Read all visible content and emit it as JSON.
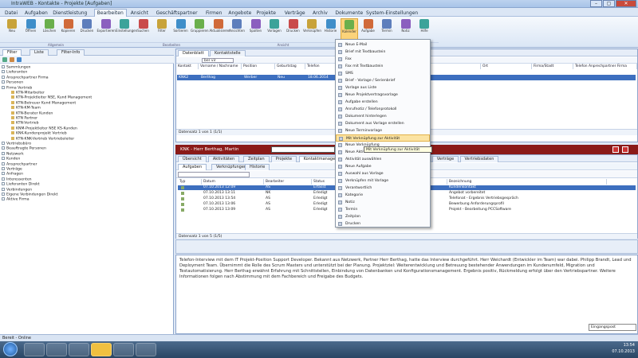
{
  "window": {
    "title": "IntraWEB - Kontakte - Projekte [Aufgaben]"
  },
  "menubar": {
    "tabs": [
      "Datei",
      "Aufgaben",
      "Dienstleistung",
      "Bearbeiten",
      "Ansicht",
      "Geschäftspartner",
      "Firmen",
      "Angebote",
      "Projekte",
      "Verträge",
      "Archiv",
      "Dokumente",
      "System-Einstellungen"
    ],
    "active_index": 3
  },
  "ribbon": {
    "buttons": [
      "Neu",
      "Öffnen",
      "Löschen",
      "Kopieren",
      "Drucken",
      "Exportieren",
      "Einstellungen",
      "Suchen",
      "Filter",
      "Sortieren",
      "Gruppieren",
      "Aktualisieren",
      "Ansichten",
      "Spalten",
      "Vorlagen",
      "Drucken",
      "Verknüpfen",
      "Historie",
      "Kalender",
      "Aufgabe",
      "Termin",
      "Notiz",
      "Hilfe"
    ],
    "selected_index": 18,
    "groups": [
      "Allgemein",
      "Bearbeiten",
      "Ansicht",
      "Extras"
    ]
  },
  "left_panel": {
    "tabs": [
      "Filter",
      "Liste",
      "Filter-Info"
    ],
    "tree": [
      {
        "label": "Sammlungen",
        "depth": 0
      },
      {
        "label": "Lieferanten",
        "depth": 0
      },
      {
        "label": "Ansprechpartner Firma",
        "depth": 0
      },
      {
        "label": "Personen",
        "depth": 0
      },
      {
        "label": "Firma Vertrieb",
        "depth": 0
      },
      {
        "label": "KTN-Mitarbeiter",
        "depth": 1
      },
      {
        "label": "KTN-Projektleiter NSE, Kund Management",
        "depth": 1
      },
      {
        "label": "KTN-Betreuer Kund Management",
        "depth": 1
      },
      {
        "label": "KTN-KM-Team",
        "depth": 1
      },
      {
        "label": "KTN-Berater Kunden",
        "depth": 1
      },
      {
        "label": "KTN Partner",
        "depth": 1
      },
      {
        "label": "KTN-Vertrieb",
        "depth": 1
      },
      {
        "label": "KNM-Projektleiter NSE KS-Kunden",
        "depth": 1
      },
      {
        "label": "KNK-Kundenprojekt Vertrieb",
        "depth": 1
      },
      {
        "label": "KTN-KNK-Vertrieb Vertriebsleiter",
        "depth": 1
      },
      {
        "label": "Vertriebsbüro",
        "depth": 0
      },
      {
        "label": "Beauftragte Personen",
        "depth": 0
      },
      {
        "label": "Netzwerk",
        "depth": 0
      },
      {
        "label": "Kunden",
        "depth": 0
      },
      {
        "label": "Ansprechpartner",
        "depth": 0
      },
      {
        "label": "Verträge",
        "depth": 0
      },
      {
        "label": "Anfragen",
        "depth": 0
      },
      {
        "label": "Interessenten",
        "depth": 0
      },
      {
        "label": "Lieferanten Direkt",
        "depth": 0
      },
      {
        "label": "Verbindungen",
        "depth": 0
      },
      {
        "label": "Eigene Verbindungen Direkt",
        "depth": 0
      },
      {
        "label": "Aktive Firma",
        "depth": 0
      }
    ]
  },
  "grid1": {
    "tabs": [
      "Datenblatt",
      "Kontaktstelle"
    ],
    "filter_value": "ber vir",
    "columns": [
      "Kontakt",
      "Vorname / Nachname",
      "Position",
      "Geburtstag",
      "Telefon",
      "Fax",
      "E-Mail",
      "PLZ",
      "Ort",
      "Firma/Stadt",
      "Telefon Anprechpartner Firma"
    ],
    "selected_row": [
      "KNK2",
      "Berthag",
      "Werber",
      "Neu",
      "18.06.2014"
    ],
    "status": "Datensatz 1 von 1 (1/1)"
  },
  "detail": {
    "bar_title": "KNK - Herr Berthag, Martin",
    "tabs": [
      "Übersicht",
      "Aktivitäten",
      "Zeitplan",
      "Projekte",
      "Kontaktmanagement",
      "Dokumente",
      "Aufgaben",
      "Notizen",
      "Verträge",
      "Vertriebsdaten"
    ],
    "subtabs": [
      "Aufgaben",
      "Verknüpfungen",
      "Historie"
    ],
    "columns": [
      "Typ",
      "Datum",
      "Bearbeiter",
      "Status",
      "Bezeichnung"
    ],
    "rows": [
      {
        "date": "07.10.2013 12:09",
        "user": "AS",
        "status": "Erfasst",
        "text": "Kundenkontakt"
      },
      {
        "date": "07.10.2013 13:11",
        "user": "NK",
        "status": "Erledigt",
        "text": "Angebot vorbereitet"
      },
      {
        "date": "07.10.2013 13:54",
        "user": "AS",
        "status": "Erledigt",
        "text": "Telefonat - Ergebnis Vertriebsgespräch"
      },
      {
        "date": "07.10.2013 13:06",
        "user": "AS",
        "status": "Erledigt",
        "text": "Bewerbung Anforderungsprofil"
      },
      {
        "date": "07.10.2013 13:09",
        "user": "AS",
        "status": "Erledigt",
        "text": "Projekt - Bearbeitung PCCSoftware"
      }
    ],
    "status": "Datensatz 1 von 5 (1/5)"
  },
  "notes": {
    "text": "Telefon-Interview mit dem IT Projekt-Position Support Developer. Bekannt aus Netzwerk, Partner Herr Berthag, hatte das Interview durchgeführt. Herr Weichardt (Entwickler im Team) war dabei. Philipp Brandt, Lead und Deployment Team. Übernimmt die Rolle des Scrum Masters und unterstützt bei der Planung. Projektziel: Weiterentwicklung und Betreuung bestehender Anwendungen im Kundenumfeld, Migration und Testautomatisierung. Herr Berthag erwähnt Erfahrung mit Schnittstellen, Einbindung von Datenbanken und Konfigurationsmanagement. Ergebnis positiv, Rückmeldung erfolgt über den Vertriebspartner. Weitere Informationen folgen nach Abstimmung mit dem Fachbereich und Freigabe des Budgets."
  },
  "context_menu": {
    "items": [
      "Neue E-Mail",
      "Brief mit Textbaustein",
      "Fax",
      "Fax mit Textbaustein",
      "SMS",
      "Brief - Vorlage / Serienbrief",
      "Vorlage aus Liste",
      "Neue Projektvertragsvorlage",
      "Aufgabe erstellen",
      "Anrufnotiz / Telefonprotokoll",
      "Dokument hinterlegen",
      "Dokument aus Vorlage erstellen",
      "Neue Terminvorlage",
      "Mit Verknüpfung zur Aktivität",
      "Neue Verknüpfung",
      "Neue Aktivität",
      "Aktivität auswählen",
      "Neue Aufgabe",
      "Auswahl aus Vorlage",
      "Verknüpfen mit Vorlage",
      "Verantwortlich",
      "Kategorie",
      "Notiz",
      "Termin",
      "Zeitplan",
      "Drucken"
    ],
    "highlight_index": 13
  },
  "tooltip": "Mit Verknüpfung zur Aktivität",
  "statusbar": {
    "left": "Bereit - Online"
  },
  "taskbar": {
    "clock": "13:54",
    "date": "07.10.2013",
    "notification": "Eingangspost"
  }
}
